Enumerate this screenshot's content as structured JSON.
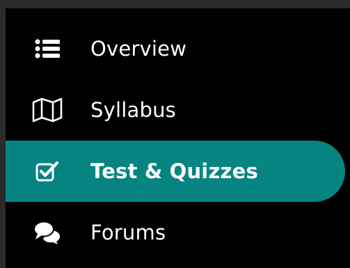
{
  "colors": {
    "background": "#000000",
    "outer_background": "#2b2b2b",
    "active_background": "#058482",
    "text": "#ffffff"
  },
  "nav": {
    "items": [
      {
        "label": "Overview",
        "icon": "list-icon",
        "active": false
      },
      {
        "label": "Syllabus",
        "icon": "map-icon",
        "active": false
      },
      {
        "label": "Test & Quizzes",
        "icon": "checkbox-icon",
        "active": true
      },
      {
        "label": "Forums",
        "icon": "comments-icon",
        "active": false
      }
    ]
  }
}
